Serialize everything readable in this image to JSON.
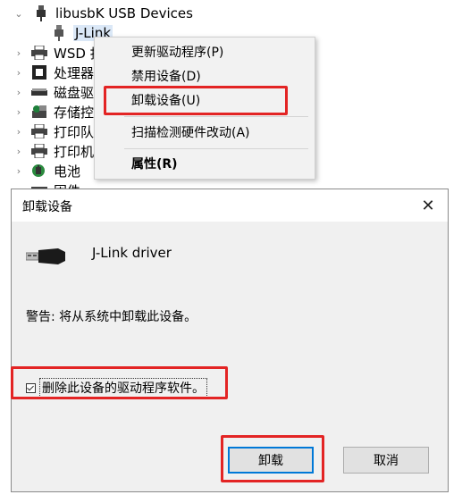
{
  "tree": {
    "items": [
      {
        "label": "libusbK USB Devices",
        "icon": "usb-plug-icon",
        "expanded": true
      },
      {
        "label": "J-Link",
        "icon": "usb-plug-icon",
        "selected": true
      },
      {
        "label": "WSD 打",
        "icon": "printer-icon"
      },
      {
        "label": "处理器",
        "icon": "processor-icon"
      },
      {
        "label": "磁盘驱",
        "icon": "disk-drive-icon"
      },
      {
        "label": "存储控",
        "icon": "storage-controller-icon"
      },
      {
        "label": "打印队",
        "icon": "printer-icon"
      },
      {
        "label": "打印机",
        "icon": "printer-icon"
      },
      {
        "label": "电池",
        "icon": "battery-icon"
      },
      {
        "label": "固件",
        "icon": "firmware-icon"
      }
    ]
  },
  "context_menu": {
    "items": [
      {
        "label": "更新驱动程序(P)"
      },
      {
        "label": "禁用设备(D)"
      },
      {
        "label": "卸载设备(U)",
        "highlighted": true
      },
      {
        "label": "扫描检测硬件改动(A)"
      },
      {
        "label": "属性(R)",
        "bold": true
      }
    ]
  },
  "dialog": {
    "title": "卸载设备",
    "close_glyph": "✕",
    "device_name": "J-Link driver",
    "warning": "警告: 将从系统中卸载此设备。",
    "checkbox_label": "删除此设备的驱动程序软件。",
    "checkbox_checked": true,
    "uninstall_button": "卸载",
    "cancel_button": "取消"
  },
  "colors": {
    "highlight_box": "#e32424",
    "dialog_bg": "#f0f0f0",
    "default_button_border": "#0078d7"
  }
}
